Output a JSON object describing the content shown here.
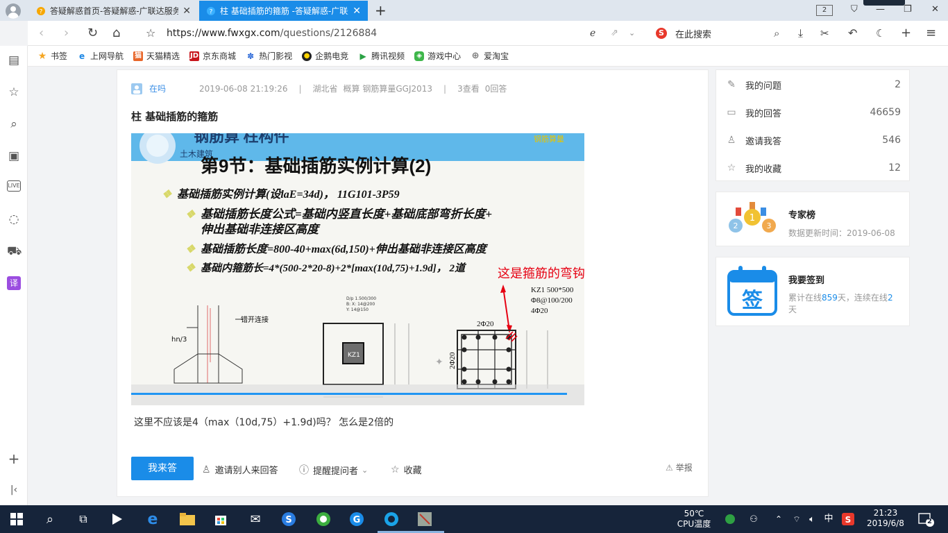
{
  "browser": {
    "tabs": [
      {
        "label": "答疑解惑首页-答疑解惑-广联达服务新"
      },
      {
        "label": "柱 基础插筋的箍筋 -答疑解惑-广联达"
      }
    ],
    "tab_count": "2",
    "url_host": "https://www.fwxgx.com",
    "url_path": "/questions/2126884",
    "search_placeholder": "在此搜索"
  },
  "bookmarks": [
    {
      "label": "书签",
      "icon": "star-icon"
    },
    {
      "label": "上网导航",
      "icon": "ie-icon"
    },
    {
      "label": "天猫精选",
      "icon": "tmall-icon"
    },
    {
      "label": "京东商城",
      "icon": "jd-icon"
    },
    {
      "label": "热门影视",
      "icon": "paw-icon"
    },
    {
      "label": "企鹅电竞",
      "icon": "penguin-icon"
    },
    {
      "label": "腾讯视频",
      "icon": "play-icon"
    },
    {
      "label": "游戏中心",
      "icon": "gamepad-icon"
    },
    {
      "label": "爱淘宝",
      "icon": "globe-icon"
    }
  ],
  "question": {
    "user": "在吗",
    "datetime": "2019-06-08 21:19:26",
    "region": "湖北省",
    "tags": "概算 钢筋算量GGJ2013",
    "views": "3查看",
    "answers": "0回答",
    "title": "柱 基础插筋的箍筋",
    "body": "这里不应该是4（max（10d,75）+1.9d)吗？ 怎么是2倍的"
  },
  "slide": {
    "header": "钢筋算 柱构件",
    "subtitle": "土木建筑",
    "title": "第9节：基础插筋实例计算(2)",
    "lines": [
      "基础插筋实例计算(设laE=34d)， 11G101-3P59",
      "基础插筋长度公式=基础内竖直长度+基础底部弯折长度+",
      "伸出基础非连接区高度",
      "基础插筋长度=800-40+max(6d,150)+伸出基础非连接区高度",
      "基础内箍筋长=4*(500-2*20-8)+2*[max(10d,75)+1.9d]， 2道"
    ],
    "annotation": "这是箍筋的弯钩平直长度",
    "kz_label": "KZ1 500*500",
    "kz_stirrup": "Φ8@100/200",
    "kz_bars": "4Φ20",
    "top_bars": "2Φ20",
    "side_bars": "2Φ20",
    "col_label": "KZ1",
    "hn3": "hn/3",
    "stagger": "错开连接"
  },
  "actions": {
    "answer": "我来答",
    "invite": "邀请别人来回答",
    "remind": "提醒提问者",
    "favorite": "收藏",
    "report": "举报"
  },
  "stats": [
    {
      "label": "我的问题",
      "value": "2",
      "icon": "question-doc-icon"
    },
    {
      "label": "我的回答",
      "value": "46659",
      "icon": "chat-icon"
    },
    {
      "label": "邀请我答",
      "value": "546",
      "icon": "person-icon"
    },
    {
      "label": "我的收藏",
      "value": "12",
      "icon": "star-outline-icon"
    }
  ],
  "expert": {
    "title": "专家榜",
    "updated": "数据更新时间：2019-06-08"
  },
  "signin": {
    "title": "我要签到",
    "badge": "签",
    "prefix": "累计在线",
    "days_total": "859",
    "mid": "天，连续在线",
    "days_streak": "2",
    "suffix": "天"
  },
  "taskbar": {
    "temp": "50℃",
    "temp_label": "CPU温度",
    "ime": "中",
    "time": "21:23",
    "date": "2019/6/8",
    "notifications": "2"
  },
  "colors": {
    "accent": "#1a8ce8",
    "taskbar": "#16243a",
    "annotation_red": "#e60012"
  }
}
